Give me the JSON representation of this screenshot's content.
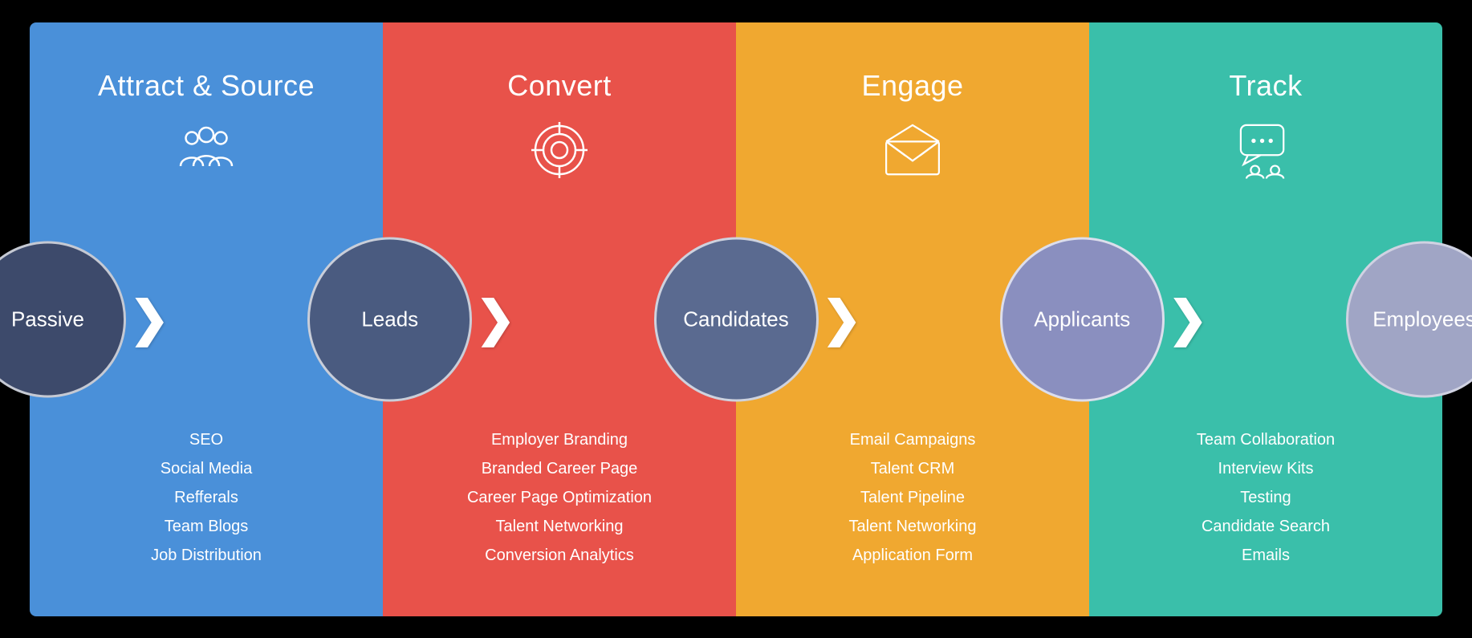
{
  "columns": [
    {
      "id": "attract",
      "title": "Attract & Source",
      "color": "#4A90D9",
      "icon": "people",
      "features": [
        "SEO",
        "Social Media",
        "Refferals",
        "Team Blogs",
        "Job Distribution"
      ]
    },
    {
      "id": "convert",
      "title": "Convert",
      "color": "#E8524A",
      "icon": "target",
      "features": [
        "Employer Branding",
        "Branded Career Page",
        "Career Page Optimization",
        "Talent Networking",
        "Conversion Analytics"
      ]
    },
    {
      "id": "engage",
      "title": "Engage",
      "color": "#F0A830",
      "icon": "email",
      "features": [
        "Email Campaigns",
        "Talent CRM",
        "Talent Pipeline",
        "Talent Networking",
        "Application Form"
      ]
    },
    {
      "id": "track",
      "title": "Track",
      "color": "#3ABFAA",
      "icon": "chat",
      "features": [
        "Team Collaboration",
        "Interview Kits",
        "Testing",
        "Candidate Search",
        "Emails"
      ]
    }
  ],
  "circles": [
    {
      "id": "passive",
      "label": "Passive",
      "bg": "#3D4A6B",
      "size": 195
    },
    {
      "id": "leads",
      "label": "Leads",
      "bg": "#4A5B80",
      "size": 200
    },
    {
      "id": "candidates",
      "label": "Candidates",
      "bg": "#5A6A90",
      "size": 200
    },
    {
      "id": "applicants",
      "label": "Applicants",
      "bg": "#8A8FBF",
      "size": 200
    },
    {
      "id": "employees",
      "label": "Employees",
      "bg": "#A0A5C5",
      "size": 195
    }
  ],
  "chevron": "❯"
}
